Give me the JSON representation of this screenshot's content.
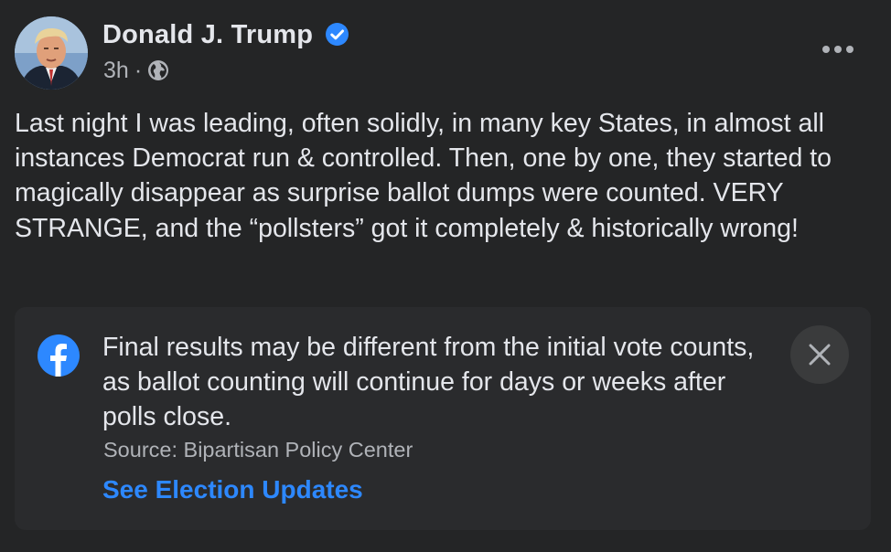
{
  "post": {
    "author": "Donald J. Trump",
    "timestamp": "3h",
    "separator": "·",
    "audience_icon": "globe-icon",
    "verified_icon": "verified-badge-icon",
    "more_icon": "more-options-icon",
    "text": "Last night I was leading, often solidly, in many key States, in almost all instances Democrat run & controlled. Then, one by one, they started to magically disappear as surprise ballot dumps were counted. VERY STRANGE, and the “pollsters” got it completely & historically wrong!"
  },
  "notice": {
    "icon": "facebook-logo-icon",
    "text": "Final results may be different from the initial vote counts, as ballot counting will continue for days or weeks after polls close.",
    "source": "Source: Bipartisan Policy Center",
    "link_label": "See Election Updates",
    "close_icon": "close-icon"
  },
  "colors": {
    "background": "#242526",
    "card": "#2a2b2d",
    "text_primary": "#e4e6eb",
    "text_secondary": "#b0b3b8",
    "link": "#2d88ff",
    "verified": "#2d88ff",
    "close_bg": "#3a3b3c"
  }
}
